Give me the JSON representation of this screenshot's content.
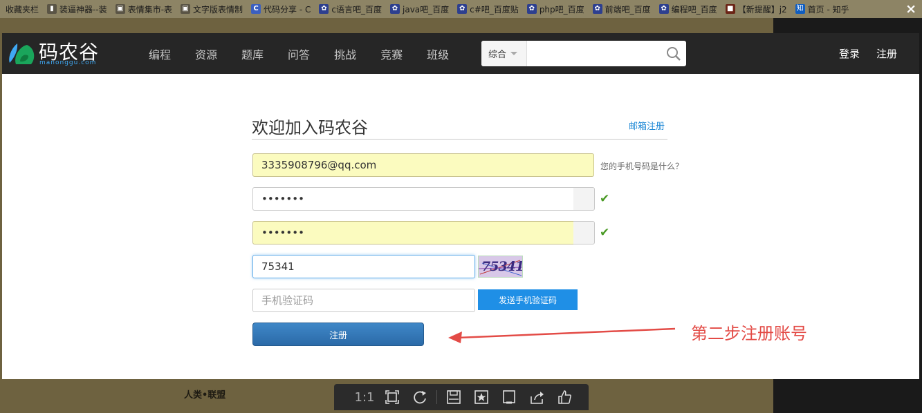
{
  "favorites_bar": {
    "items": [
      {
        "label": "收藏夹栏",
        "icon": "none"
      },
      {
        "label": "装逼神器--装",
        "icon": "bookmark-icon"
      },
      {
        "label": "表情集市-表",
        "icon": "image-icon"
      },
      {
        "label": "文字版表情制",
        "icon": "image-icon"
      },
      {
        "label": "代码分享 - C",
        "icon": "c-icon"
      },
      {
        "label": "c语言吧_百度",
        "icon": "baidu-paw-icon"
      },
      {
        "label": "java吧_百度",
        "icon": "baidu-paw-icon"
      },
      {
        "label": "c#吧_百度贴",
        "icon": "baidu-paw-icon"
      },
      {
        "label": "php吧_百度",
        "icon": "baidu-paw-icon"
      },
      {
        "label": "前端吧_百度",
        "icon": "baidu-paw-icon"
      },
      {
        "label": "编程吧_百度",
        "icon": "baidu-paw-icon"
      },
      {
        "label": "【新提醒】j2",
        "icon": "forum-icon"
      },
      {
        "label": "首页 - 知乎",
        "icon": "zhihu-icon"
      }
    ]
  },
  "viewer_close": "×",
  "header": {
    "logo_text": "码农谷",
    "logo_sub": "manonggu.com",
    "nav": [
      "编程",
      "资源",
      "题库",
      "问答",
      "挑战",
      "竞赛",
      "班级"
    ],
    "search": {
      "category": "综合",
      "placeholder": ""
    },
    "login": "登录",
    "register": "注册"
  },
  "form": {
    "title": "欢迎加入码农谷",
    "email_register_link": "邮箱注册",
    "account_value": "3335908796@qq.com",
    "account_hint": "您的手机号码是什么？",
    "password_value": "•••••••",
    "confirm_password_value": "•••••••",
    "toggle_glyph": "",
    "check_mark": "✔",
    "captcha_input_value": "75341",
    "captcha_image_text": "75341",
    "sms_placeholder": "手机验证码",
    "send_sms_button": "发送手机验证码",
    "submit_button": "注册"
  },
  "annotation": {
    "text": "第二步注册账号",
    "color": "#e34b46"
  },
  "background_page": {
    "footer_text": "人类•联盟"
  },
  "viewer_toolbar": {
    "ratio_label": "1:1"
  },
  "colors": {
    "header_bg": "#262626",
    "accent_blue": "#1f8fe6",
    "input_yellow": "#fbfbbf",
    "valid_green": "#4a9a25"
  }
}
